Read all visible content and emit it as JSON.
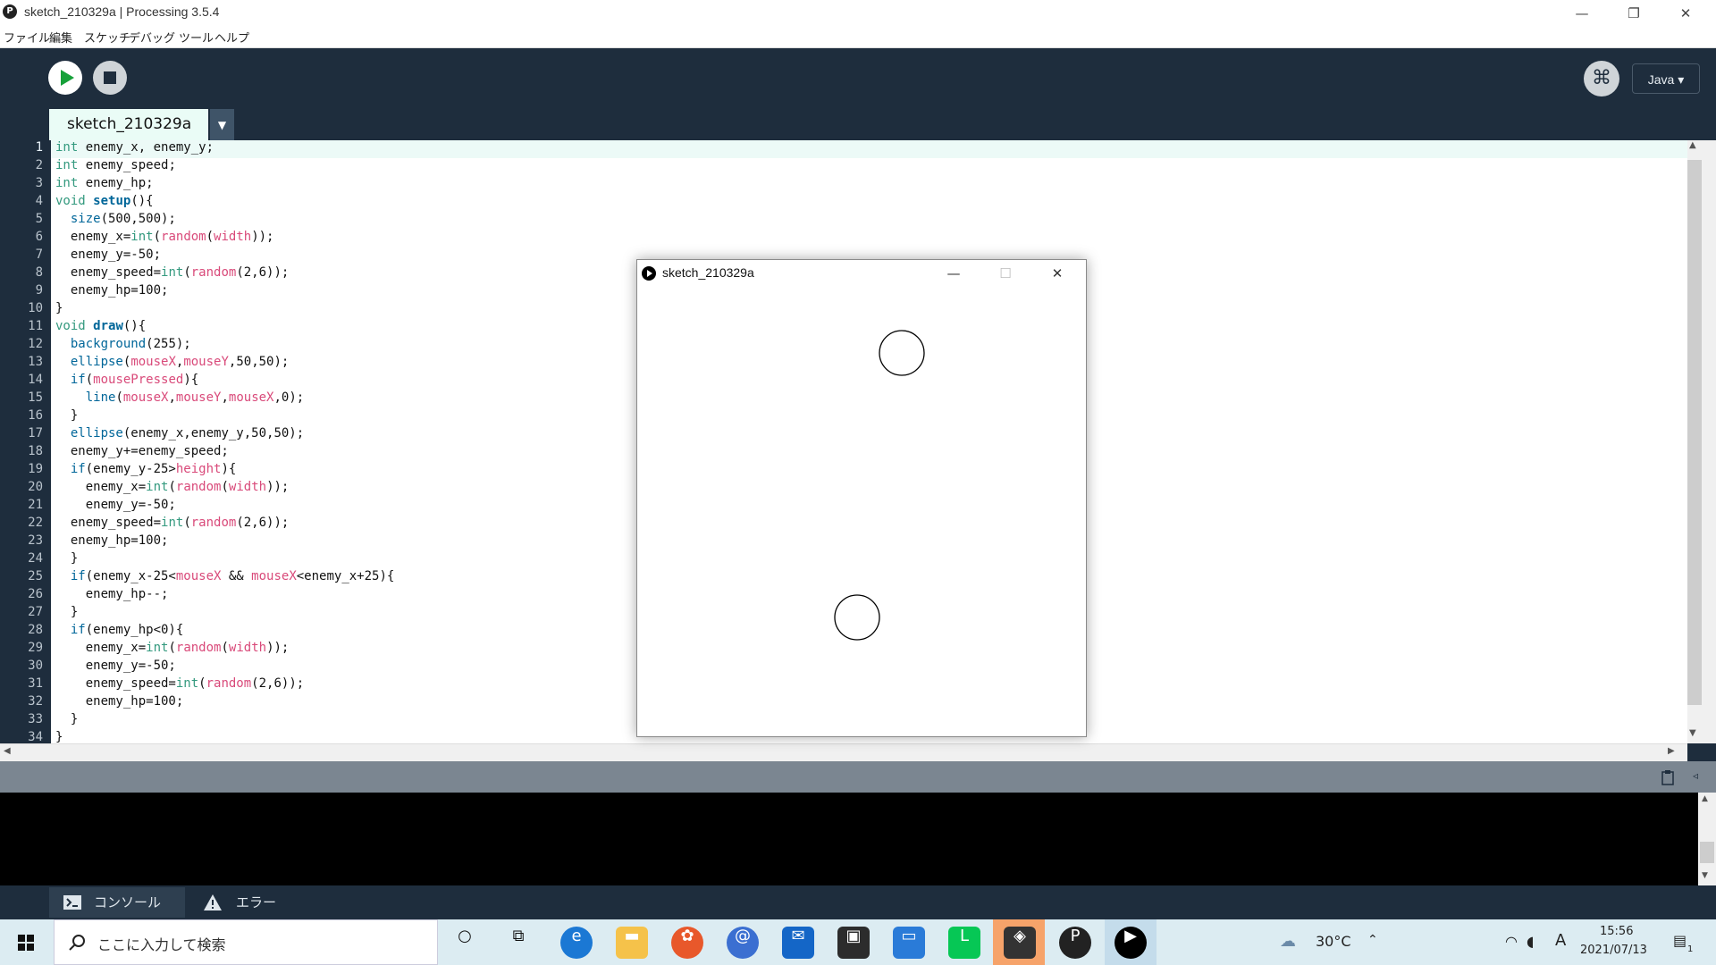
{
  "window": {
    "title": "sketch_210329a | Processing 3.5.4",
    "logo_glyph": "P",
    "minimize_glyph": "—",
    "restore_glyph": "❐",
    "close_glyph": "✕"
  },
  "menu": [
    "ファイル",
    "編集",
    "スケッチ",
    "デバッグ",
    "ツール",
    "ヘルプ"
  ],
  "toolbar": {
    "run_icon": "play-icon",
    "stop_icon": "stop-icon",
    "debug_glyph": "⌘",
    "mode_label": "Java ▾"
  },
  "tab": {
    "label": "sketch_210329a",
    "menu_glyph": "▼"
  },
  "editor": {
    "active_line": 1,
    "line_numbers": [
      "1",
      "2",
      "3",
      "4",
      "5",
      "6",
      "7",
      "8",
      "9",
      "10",
      "11",
      "12",
      "13",
      "14",
      "15",
      "16",
      "17",
      "18",
      "19",
      "20",
      "21",
      "22",
      "23",
      "24",
      "25",
      "26",
      "27",
      "28",
      "29",
      "30",
      "31",
      "32",
      "33",
      "34"
    ],
    "lines": [
      "int enemy_x, enemy_y;",
      "int enemy_speed;",
      "int enemy_hp;",
      "void setup(){",
      "  size(500,500);",
      "  enemy_x=int(random(width));",
      "  enemy_y=-50;",
      "  enemy_speed=int(random(2,6));",
      "  enemy_hp=100;",
      "}",
      "void draw(){",
      "  background(255);",
      "  ellipse(mouseX,mouseY,50,50);",
      "  if(mousePressed){",
      "    line(mouseX,mouseY,mouseX,0);",
      "  }",
      "  ellipse(enemy_x,enemy_y,50,50);",
      "  enemy_y+=enemy_speed;",
      "  if(enemy_y-25>height){",
      "    enemy_x=int(random(width));",
      "    enemy_y=-50;",
      "  enemy_speed=int(random(2,6));",
      "  enemy_hp=100;",
      "  }",
      "  if(enemy_x-25<mouseX && mouseX<enemy_x+25){",
      "    enemy_hp--;",
      "  }",
      "  if(enemy_hp<0){",
      "    enemy_x=int(random(width));",
      "    enemy_y=-50;",
      "    enemy_speed=int(random(2,6));",
      "    enemy_hp=100;",
      "  }",
      "}"
    ],
    "colors": {
      "keyword": "#33997e",
      "function": "#006699",
      "builtin": "#d94a7a",
      "text": "#111111"
    }
  },
  "scroll": {
    "up": "▲",
    "down": "▼",
    "left": "◀",
    "right": "▶"
  },
  "statusbar": {
    "copy_icon": "clipboard-icon",
    "collapse_glyph": "◃"
  },
  "console_tabs": [
    {
      "label": "コンソール",
      "icon": "console-icon"
    },
    {
      "label": "エラー",
      "icon": "warning-icon"
    }
  ],
  "sketch_window": {
    "title": "sketch_210329a",
    "minimize_glyph": "—",
    "maximize_glyph": "☐",
    "close_glyph": "✕"
  },
  "taskbar": {
    "search_placeholder": "ここに入力して検索",
    "weather": "30°C",
    "ime": "A",
    "time": "15:56",
    "date": "2021/07/13",
    "notification_count": "1",
    "apps": [
      "cortana-icon",
      "task-view-icon",
      "edge-icon",
      "explorer-icon",
      "photo-app-icon",
      "mail-app-icon",
      "mail-icon",
      "store-icon",
      "remote-desktop-icon",
      "line-icon",
      "unity-icon",
      "processing-icon",
      "sketch-run-icon"
    ]
  }
}
